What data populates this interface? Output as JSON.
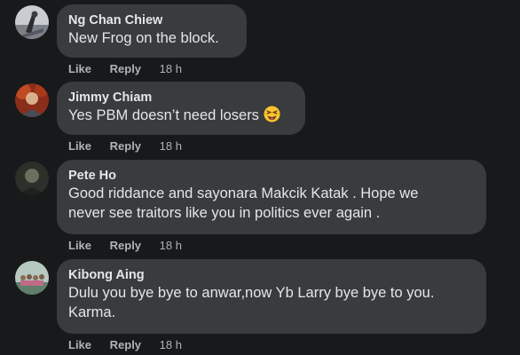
{
  "comments": [
    {
      "author": "Ng Chan Chiew",
      "text": "New Frog on the block.",
      "like_label": "Like",
      "reply_label": "Reply",
      "time": "18 h"
    },
    {
      "author": "Jimmy Chiam",
      "text": "Yes PBM doesn’t need losers",
      "emoji": "squinting-face-with-tongue",
      "like_label": "Like",
      "reply_label": "Reply",
      "time": "18 h"
    },
    {
      "author": "Pete Ho",
      "text": "Good riddance and sayonara Makcik Katak . Hope we\nnever see traitors like you in politics ever again .",
      "like_label": "Like",
      "reply_label": "Reply",
      "time": "18 h"
    },
    {
      "author": "Kibong Aing",
      "text": "Dulu you bye bye to anwar,now Yb Larry bye bye to you.\nKarma.",
      "like_label": "Like",
      "reply_label": "Reply",
      "time": "18 h"
    }
  ],
  "colors": {
    "background": "#18191a",
    "bubble": "#3a3b3c",
    "text": "#e4e6eb",
    "secondary": "#b0b3b8"
  }
}
